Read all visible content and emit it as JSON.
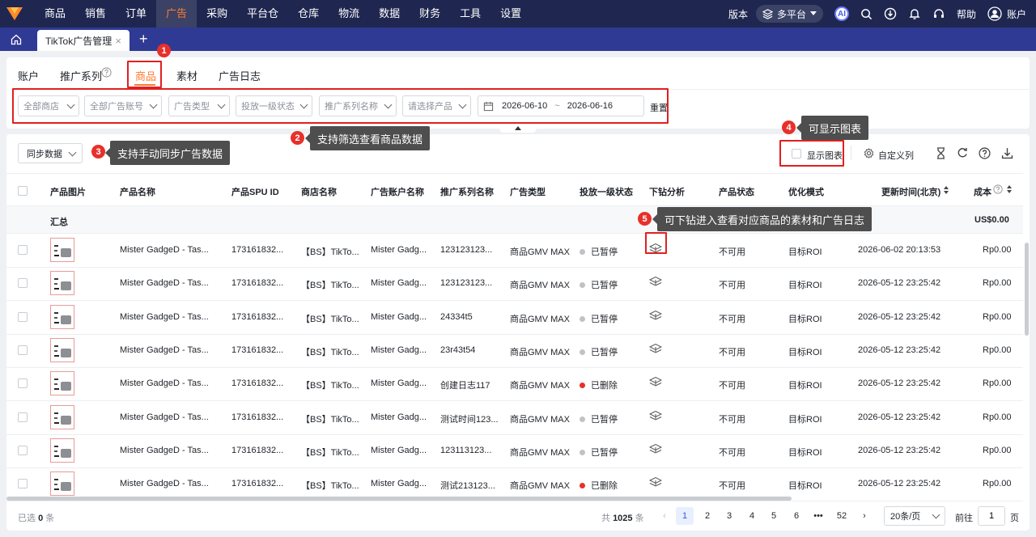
{
  "top_nav": {
    "items": [
      "商品",
      "销售",
      "订单",
      "广告",
      "采购",
      "平台仓",
      "仓库",
      "物流",
      "数据",
      "财务",
      "工具",
      "设置"
    ],
    "active": "广告",
    "version_label": "版本",
    "platform_label": "多平台",
    "ai_label": "AI",
    "help_label": "帮助",
    "account_label": "账户"
  },
  "tab_bar": {
    "page_tab_label": "TikTok广告管理",
    "close_glyph": "×",
    "add_glyph": "+"
  },
  "sub_tabs": [
    "账户",
    "推广系列",
    "商品",
    "素材",
    "广告日志"
  ],
  "active_sub_tab": "商品",
  "filters": {
    "shop": "全部商店",
    "ad_account": "全部广告账号",
    "ad_type": "广告类型",
    "status": "投放一级状态",
    "campaign": "推广系列名称",
    "product": "请选择产品",
    "date_start": "2026-06-10",
    "date_sep": "~",
    "date_end": "2026-06-16",
    "reset_label": "重置"
  },
  "toolbar": {
    "sync_label": "同步数据",
    "show_chart_label": "显示图表",
    "custom_columns_label": "自定义列"
  },
  "annotations": [
    {
      "num": "1",
      "text": ""
    },
    {
      "num": "2",
      "text": "支持筛选查看商品数据"
    },
    {
      "num": "3",
      "text": "支持手动同步广告数据"
    },
    {
      "num": "4",
      "text": "可显示图表"
    },
    {
      "num": "5",
      "text": "可下钻进入查看对应商品的素材和广告日志"
    }
  ],
  "table": {
    "headers": [
      "产品图片",
      "产品名称",
      "产品SPU ID",
      "商店名称",
      "广告账户名称",
      "推广系列名称",
      "广告类型",
      "投放一级状态",
      "下钻分析",
      "产品状态",
      "优化模式",
      "更新时间(北京)",
      "成本"
    ],
    "summary": {
      "label": "汇总",
      "cost": "US$0.00"
    },
    "rows": [
      {
        "name": "Mister GadgeD - Tas...",
        "spu": "173161832...",
        "shop": "【BS】TikTo...",
        "account": "Mister Gadg...",
        "campaign": "123123123...",
        "type": "商品GMV MAX",
        "status": "已暂停",
        "status_color": "#bfc3c8",
        "product_status": "不可用",
        "mode": "目标ROI",
        "updated": "2026-06-02 20:13:53",
        "cost": "Rp0.00"
      },
      {
        "name": "Mister GadgeD - Tas...",
        "spu": "173161832...",
        "shop": "【BS】TikTo...",
        "account": "Mister Gadg...",
        "campaign": "123123123...",
        "type": "商品GMV MAX",
        "status": "已暂停",
        "status_color": "#bfc3c8",
        "product_status": "不可用",
        "mode": "目标ROI",
        "updated": "2026-05-12 23:25:42",
        "cost": "Rp0.00"
      },
      {
        "name": "Mister GadgeD - Tas...",
        "spu": "173161832...",
        "shop": "【BS】TikTo...",
        "account": "Mister Gadg...",
        "campaign": "24334t5",
        "type": "商品GMV MAX",
        "status": "已暂停",
        "status_color": "#bfc3c8",
        "product_status": "不可用",
        "mode": "目标ROI",
        "updated": "2026-05-12 23:25:42",
        "cost": "Rp0.00"
      },
      {
        "name": "Mister GadgeD - Tas...",
        "spu": "173161832...",
        "shop": "【BS】TikTo...",
        "account": "Mister Gadg...",
        "campaign": "23r43t54",
        "type": "商品GMV MAX",
        "status": "已暂停",
        "status_color": "#bfc3c8",
        "product_status": "不可用",
        "mode": "目标ROI",
        "updated": "2026-05-12 23:25:42",
        "cost": "Rp0.00"
      },
      {
        "name": "Mister GadgeD - Tas...",
        "spu": "173161832...",
        "shop": "【BS】TikTo...",
        "account": "Mister Gadg...",
        "campaign": "创建日志117",
        "type": "商品GMV MAX",
        "status": "已删除",
        "status_color": "#e8302a",
        "product_status": "不可用",
        "mode": "目标ROI",
        "updated": "2026-05-12 23:25:42",
        "cost": "Rp0.00"
      },
      {
        "name": "Mister GadgeD - Tas...",
        "spu": "173161832...",
        "shop": "【BS】TikTo...",
        "account": "Mister Gadg...",
        "campaign": "测试时间123...",
        "type": "商品GMV MAX",
        "status": "已暂停",
        "status_color": "#bfc3c8",
        "product_status": "不可用",
        "mode": "目标ROI",
        "updated": "2026-05-12 23:25:42",
        "cost": "Rp0.00"
      },
      {
        "name": "Mister GadgeD - Tas...",
        "spu": "173161832...",
        "shop": "【BS】TikTo...",
        "account": "Mister Gadg...",
        "campaign": "123113123...",
        "type": "商品GMV MAX",
        "status": "已暂停",
        "status_color": "#bfc3c8",
        "product_status": "不可用",
        "mode": "目标ROI",
        "updated": "2026-05-12 23:25:42",
        "cost": "Rp0.00"
      },
      {
        "name": "Mister GadgeD - Tas...",
        "spu": "173161832...",
        "shop": "【BS】TikTo...",
        "account": "Mister Gadg...",
        "campaign": "测试213123...",
        "type": "商品GMV MAX",
        "status": "已删除",
        "status_color": "#e8302a",
        "product_status": "不可用",
        "mode": "目标ROI",
        "updated": "2026-05-12 23:25:42",
        "cost": "Rp0.00"
      }
    ]
  },
  "footer": {
    "selected_prefix": "已选",
    "selected_count": "0",
    "selected_suffix": "条",
    "total_prefix": "共",
    "total": "1025",
    "total_suffix": "条",
    "pages": [
      "1",
      "2",
      "3",
      "4",
      "5",
      "6",
      "•••",
      "52"
    ],
    "current_page": "1",
    "page_size": "20条/页",
    "goto_label": "前往",
    "goto_value": "1",
    "goto_suffix": "页"
  },
  "colors": {
    "accent": "#ff7a2f",
    "nav_bg": "#1f2750",
    "tabbar_bg": "#2f3a94",
    "annotation_red": "#e02020"
  }
}
